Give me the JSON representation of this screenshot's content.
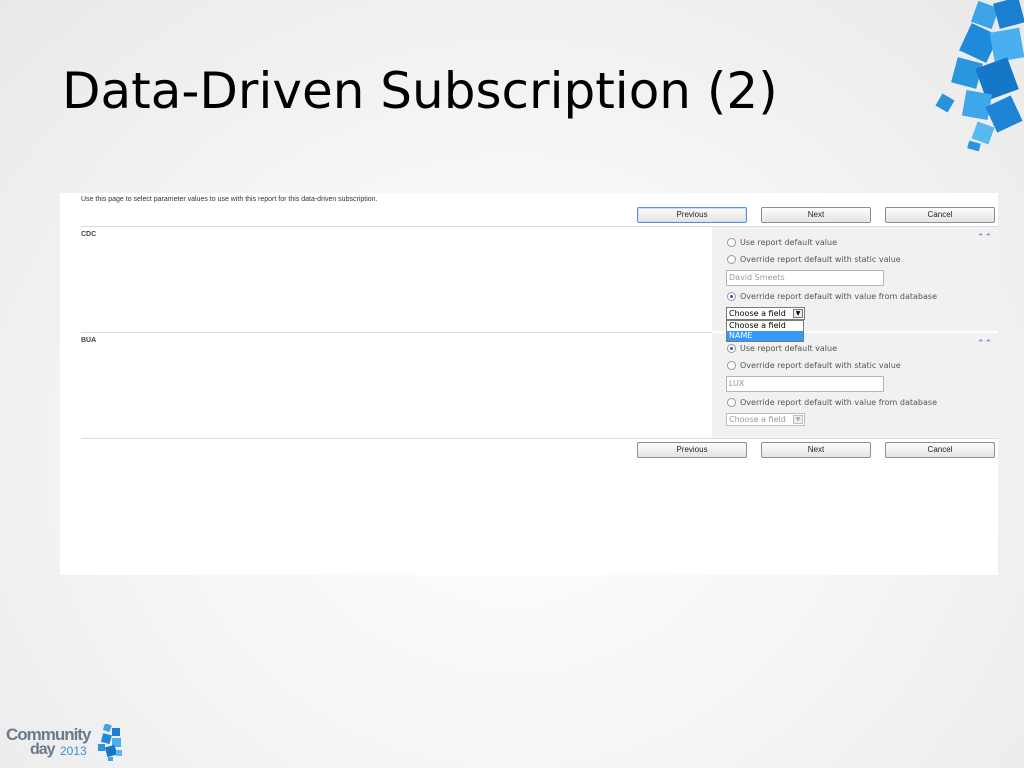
{
  "slide": {
    "title": "Data-Driven Subscription (2)"
  },
  "form": {
    "intro": "Use this page to select parameter values to use with this report for this data-driven subscription.",
    "buttons": {
      "previous": "Previous",
      "next": "Next",
      "cancel": "Cancel"
    },
    "options": {
      "use_default": "Use report default value",
      "override_static": "Override report default with static value",
      "override_database": "Override report default with value from database"
    },
    "parameters": [
      {
        "name": "CDC",
        "selected_option": "override_database",
        "static_value": "David Smeets",
        "field_select": "Choose a field",
        "dropdown_open": true,
        "dropdown_items": [
          "Choose a field",
          "NAME"
        ],
        "dropdown_highlighted": "NAME"
      },
      {
        "name": "BUA",
        "selected_option": "use_default",
        "static_value": "LUX",
        "field_select": "Choose a field",
        "dropdown_open": false
      }
    ],
    "collapse_icon": "double-chevron-up-icon"
  },
  "logo": {
    "line1": "Community",
    "line2": "day",
    "year": "2013"
  },
  "colors": {
    "accent": "#3a8fd6",
    "cube_blue": "#1e88d8"
  }
}
